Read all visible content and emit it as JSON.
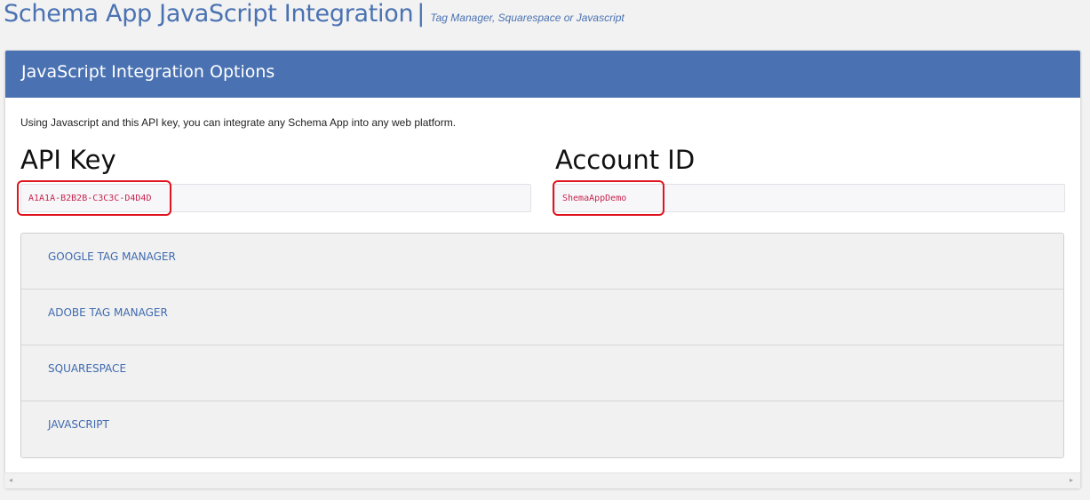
{
  "header": {
    "title": "Schema App JavaScript Integration",
    "separator": "|",
    "subtitle": "Tag Manager, Squarespace or Javascript"
  },
  "panel": {
    "title": "JavaScript Integration Options",
    "intro": "Using Javascript and this API key, you can integrate any Schema App into any web platform."
  },
  "fields": {
    "api_key": {
      "label": "API Key",
      "value": "A1A1A-B2B2B-C3C3C-D4D4D"
    },
    "account_id": {
      "label": "Account ID",
      "value": "ShemaAppDemo"
    }
  },
  "accordion": {
    "items": [
      {
        "label": "GOOGLE TAG MANAGER"
      },
      {
        "label": "ADOBE TAG MANAGER"
      },
      {
        "label": "SQUARESPACE"
      },
      {
        "label": "JAVASCRIPT"
      }
    ]
  },
  "scrollbar": {
    "left_arrow": "◂",
    "right_arrow": "▸"
  },
  "colors": {
    "accent": "#4a72b2",
    "code_text": "#c7254e",
    "highlight_border": "#e0141e"
  }
}
